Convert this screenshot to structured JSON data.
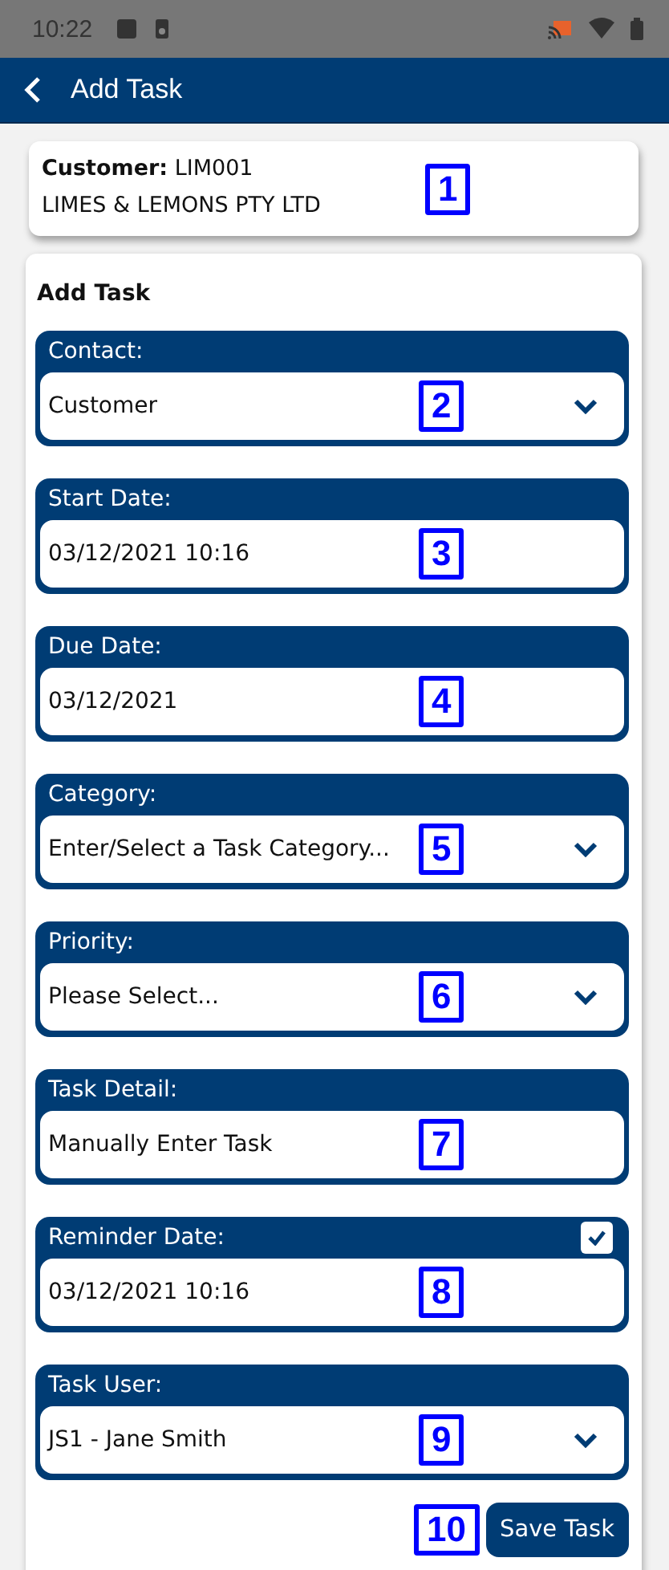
{
  "status_bar": {
    "time": "10:22"
  },
  "app_bar": {
    "title": "Add Task"
  },
  "customer": {
    "label": "Customer:",
    "code": "LIM001",
    "name": "LIMES & LEMONS PTY LTD",
    "callout": "1"
  },
  "form": {
    "title": "Add Task",
    "fields": [
      {
        "kind": "select",
        "label": "Contact:",
        "value": "Customer",
        "callout": "2"
      },
      {
        "kind": "text",
        "label": "Start Date:",
        "value": "03/12/2021 10:16",
        "callout": "3"
      },
      {
        "kind": "text",
        "label": "Due Date:",
        "value": "03/12/2021",
        "callout": "4"
      },
      {
        "kind": "select",
        "label": "Category:",
        "value": "Enter/Select a Task Category...",
        "callout": "5"
      },
      {
        "kind": "select",
        "label": "Priority:",
        "value": "Please Select...",
        "callout": "6"
      },
      {
        "kind": "text",
        "label": "Task Detail:",
        "value": "Manually Enter Task",
        "callout": "7"
      },
      {
        "kind": "text",
        "label": "Reminder Date:",
        "value": "03/12/2021 10:16",
        "callout": "8",
        "checkbox": {
          "checked": true
        }
      },
      {
        "kind": "select",
        "label": "Task User:",
        "value": "JS1 - Jane Smith",
        "callout": "9"
      }
    ],
    "save": {
      "label": "Save Task",
      "callout": "10"
    }
  }
}
